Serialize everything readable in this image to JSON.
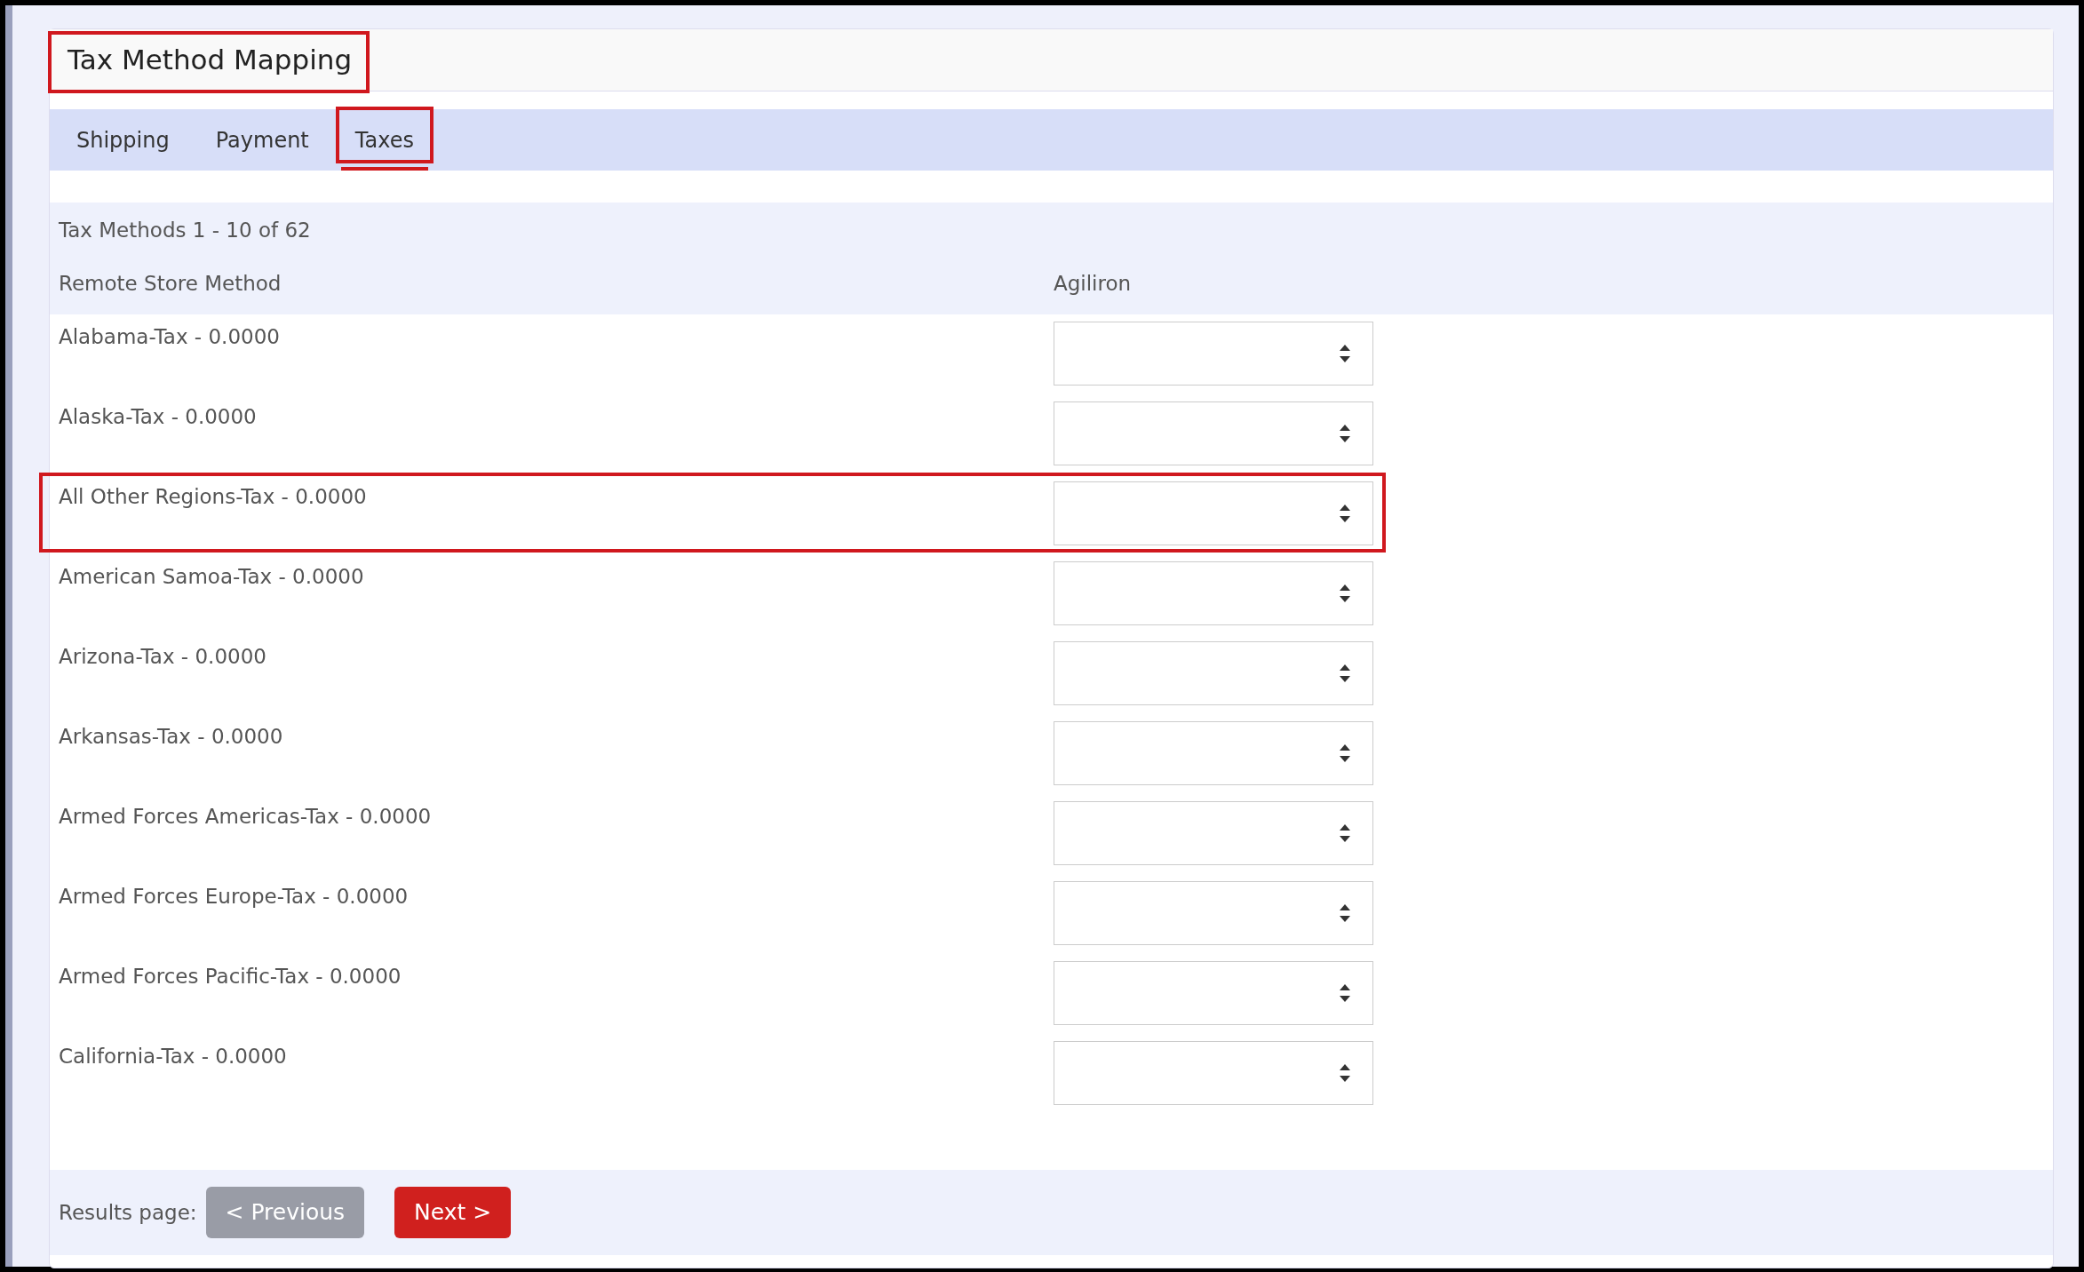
{
  "header": {
    "title": "Tax Method Mapping",
    "highlighted": true
  },
  "tabs": [
    {
      "label": "Shipping",
      "selected": false,
      "highlighted": false
    },
    {
      "label": "Payment",
      "selected": false,
      "highlighted": false
    },
    {
      "label": "Taxes",
      "selected": true,
      "highlighted": true
    }
  ],
  "summary": "Tax Methods 1 - 10 of 62",
  "table": {
    "columns": [
      "Remote Store Method",
      "Agiliron"
    ],
    "rows": [
      {
        "method": "Alabama-Tax - 0.0000",
        "highlighted": false
      },
      {
        "method": "Alaska-Tax - 0.0000",
        "highlighted": false
      },
      {
        "method": "All Other Regions-Tax - 0.0000",
        "highlighted": true
      },
      {
        "method": "American Samoa-Tax - 0.0000",
        "highlighted": false
      },
      {
        "method": "Arizona-Tax - 0.0000",
        "highlighted": false
      },
      {
        "method": "Arkansas-Tax - 0.0000",
        "highlighted": false
      },
      {
        "method": "Armed Forces Americas-Tax - 0.0000",
        "highlighted": false
      },
      {
        "method": "Armed Forces Europe-Tax - 0.0000",
        "highlighted": false
      },
      {
        "method": "Armed Forces Pacific-Tax - 0.0000",
        "highlighted": false
      },
      {
        "method": "California-Tax - 0.0000",
        "highlighted": false
      }
    ]
  },
  "pagination": {
    "label": "Results page:",
    "buttons": [
      {
        "label": "< Previous",
        "disabled": true
      },
      {
        "label": "Next >",
        "disabled": false
      }
    ]
  }
}
